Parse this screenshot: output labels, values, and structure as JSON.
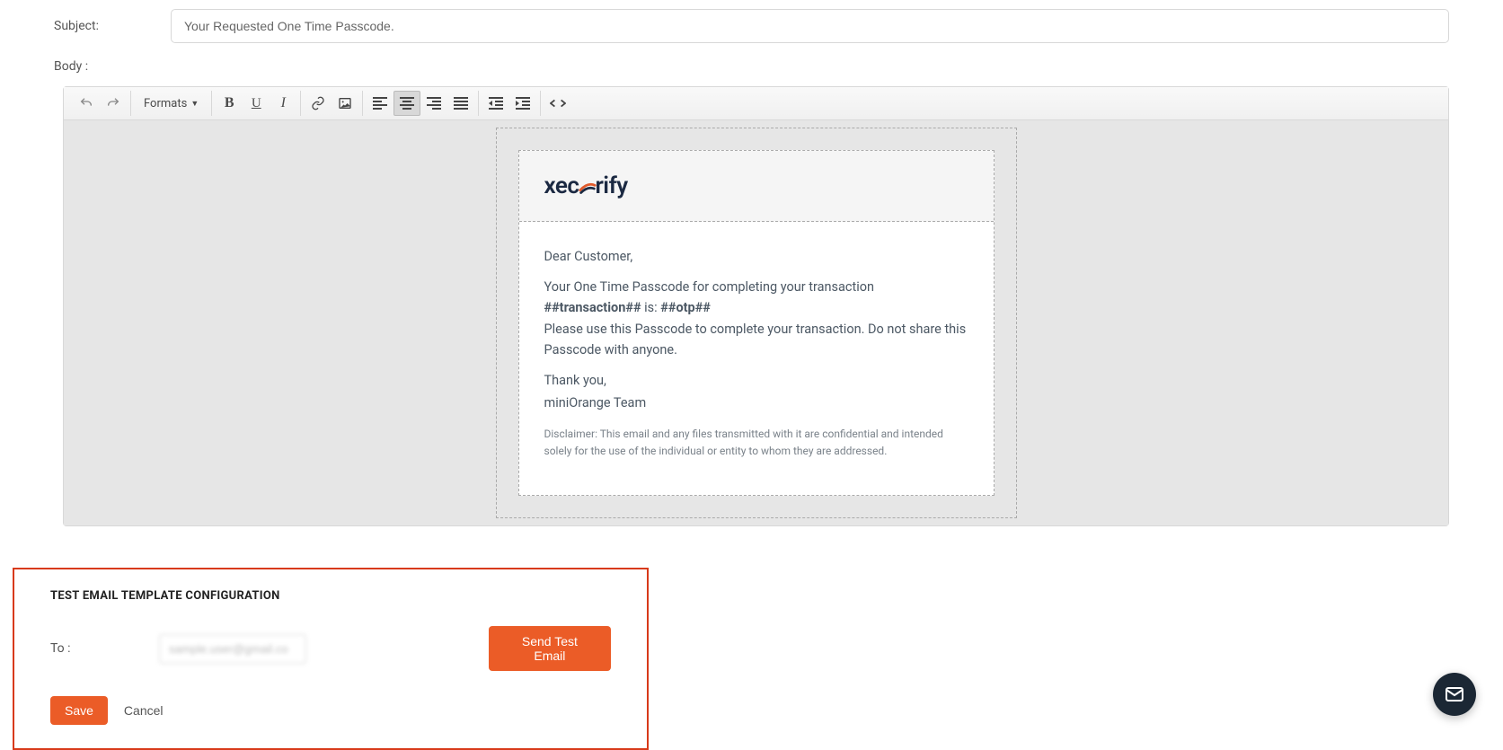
{
  "subject": {
    "label": "Subject:",
    "value": "Your Requested One Time Passcode."
  },
  "body_label": "Body :",
  "toolbar": {
    "formats_label": "Formats"
  },
  "email": {
    "logo_pre": "xec",
    "logo_post": "rify",
    "greeting": "Dear Customer,",
    "line1": "Your One Time Passcode for completing your transaction ",
    "tx_token": "##transaction##",
    "mid": " is: ",
    "otp_token": "##otp##",
    "line2": "Please use this Passcode to complete your transaction. Do not share this Passcode with anyone.",
    "thank": "Thank you,",
    "team": "miniOrange Team",
    "disclaimer": "Disclaimer: This email and any files transmitted with it are confidential and intended solely for the use of the individual or entity to whom they are addressed."
  },
  "test": {
    "title": "TEST EMAIL TEMPLATE CONFIGURATION",
    "to_label": "To :",
    "to_value": "sample.user@gmail.co",
    "send_label": "Send Test Email"
  },
  "actions": {
    "save": "Save",
    "cancel": "Cancel"
  }
}
